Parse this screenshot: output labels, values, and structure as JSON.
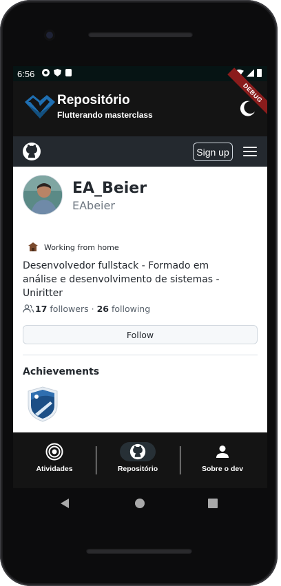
{
  "status_bar": {
    "time": "6:56",
    "debug_label": "DEBUG"
  },
  "app_bar": {
    "title": "Repositório",
    "subtitle": "Flutterando masterclass",
    "theme_icon": "moon-icon"
  },
  "github_header": {
    "logo_icon": "github-icon",
    "signup_label": "Sign up",
    "menu_icon": "hamburger-menu-icon"
  },
  "profile": {
    "name": "EA_Beier",
    "username": "EAbeier",
    "status": "Working from home",
    "bio": "Desenvolvedor fullstack - Formado em análise e desenvolvimento de sistemas - Uniritter",
    "followers_count": "17",
    "followers_label": "followers",
    "separator": "·",
    "following_count": "26",
    "following_label": "following",
    "follow_label": "Follow"
  },
  "achievements": {
    "title": "Achievements"
  },
  "bottom_nav": {
    "items": [
      {
        "label": "Atividades",
        "icon": "target-icon",
        "active": false
      },
      {
        "label": "Repositório",
        "icon": "github-icon",
        "active": true
      },
      {
        "label": "Sobre o dev",
        "icon": "person-icon",
        "active": false
      }
    ]
  },
  "colors": {
    "app_bar_bg": "#141414",
    "github_header_bg": "#24292f",
    "logo_blue": "#1f6fb2",
    "active_nav_pill": "#273036"
  }
}
